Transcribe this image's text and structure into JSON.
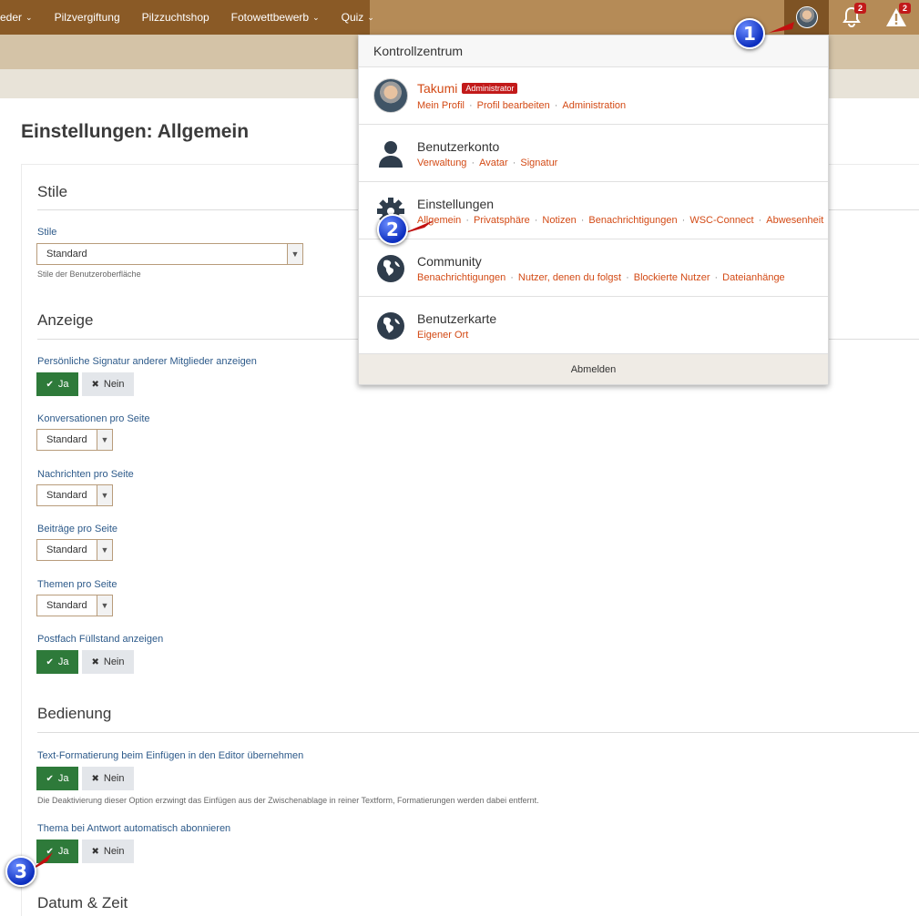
{
  "nav": {
    "items": [
      {
        "label": "eder",
        "caret": true
      },
      {
        "label": "Pilzvergiftung",
        "caret": false
      },
      {
        "label": "Pilzzuchtshop",
        "caret": false
      },
      {
        "label": "Fotowettbewerb",
        "caret": true
      },
      {
        "label": "Quiz",
        "caret": true
      }
    ],
    "notifications_count": "2",
    "alerts_count": "2"
  },
  "page": {
    "title": "Einstellungen: Allgemein"
  },
  "sections": {
    "stile": {
      "title": "Stile",
      "field_label": "Stile",
      "select_value": "Standard",
      "description": "Stile der Benutzeroberfläche"
    },
    "anzeige": {
      "title": "Anzeige",
      "signatur_label": "Persönliche Signatur anderer Mitglieder anzeigen",
      "konversationen_label": "Konversationen pro Seite",
      "nachrichten_label": "Nachrichten pro Seite",
      "beitraege_label": "Beiträge pro Seite",
      "themen_label": "Themen pro Seite",
      "postfach_label": "Postfach Füllstand anzeigen",
      "select_value": "Standard"
    },
    "bedienung": {
      "title": "Bedienung",
      "textformat_label": "Text-Formatierung beim Einfügen in den Editor übernehmen",
      "textformat_desc": "Die Deaktivierung dieser Option erzwingt das Einfügen aus der Zwischenablage in reiner Textform, Formatierungen werden dabei entfernt.",
      "abonnieren_label": "Thema bei Antwort automatisch abonnieren"
    },
    "datum": {
      "title": "Datum & Zeit"
    }
  },
  "buttons": {
    "yes": "Ja",
    "no": "Nein"
  },
  "panel": {
    "title": "Kontrollzentrum",
    "user": {
      "name": "Takumi",
      "badge": "Administrator",
      "links": [
        "Mein Profil",
        "Profil bearbeiten",
        "Administration"
      ]
    },
    "konto": {
      "title": "Benutzerkonto",
      "links": [
        "Verwaltung",
        "Avatar",
        "Signatur"
      ]
    },
    "einstellungen": {
      "title": "Einstellungen",
      "links": [
        "Allgemein",
        "Privatsphäre",
        "Notizen",
        "Benachrichtigungen",
        "WSC-Connect",
        "Abwesenheit"
      ]
    },
    "community": {
      "title": "Community",
      "links": [
        "Benachrichtigungen",
        "Nutzer, denen du folgst",
        "Blockierte Nutzer",
        "Dateianhänge"
      ]
    },
    "karte": {
      "title": "Benutzerkarte",
      "links": [
        "Eigener Ort"
      ]
    },
    "logout": "Abmelden"
  },
  "annotations": [
    "1",
    "2",
    "3"
  ],
  "colors": {
    "nav_dark": "#8a5a26",
    "nav_light": "#b58b57",
    "link": "#d34a15",
    "yes_green": "#2e7a3a",
    "badge_red": "#c21a1a",
    "marker_blue": "#0d2fbf"
  }
}
